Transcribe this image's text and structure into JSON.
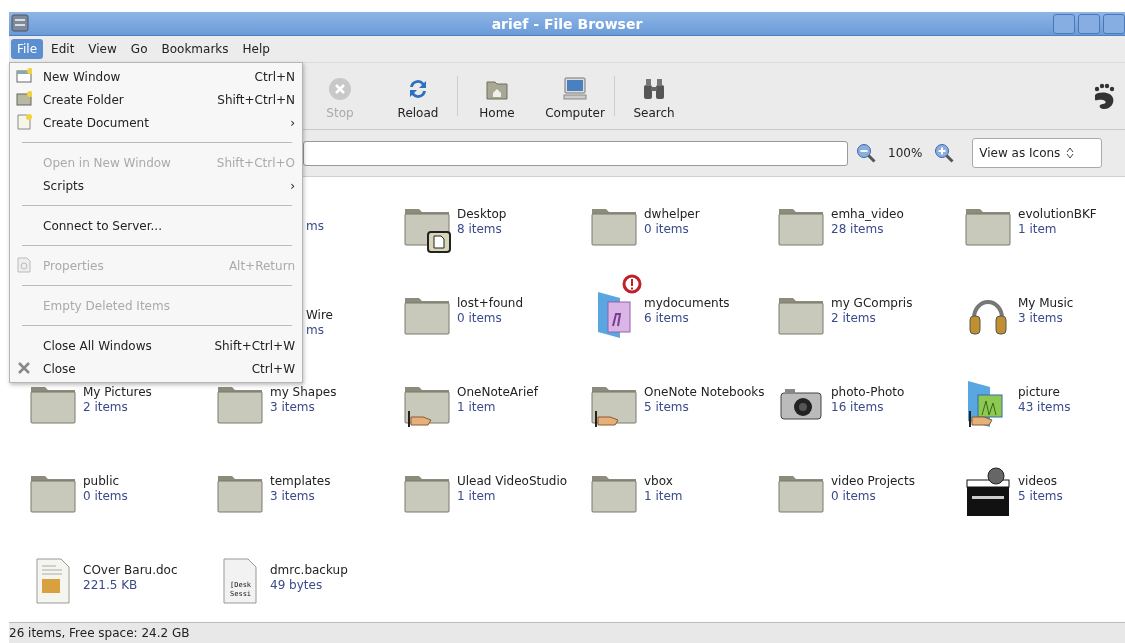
{
  "window": {
    "title": "arief - File Browser"
  },
  "menubar": [
    {
      "label": "File",
      "selected": true
    },
    {
      "label": "Edit",
      "selected": false
    },
    {
      "label": "View",
      "selected": false
    },
    {
      "label": "Go",
      "selected": false
    },
    {
      "label": "Bookmarks",
      "selected": false
    },
    {
      "label": "Help",
      "selected": false
    }
  ],
  "file_menu": [
    {
      "kind": "new-window",
      "label": "New Window",
      "shortcut": "Ctrl+N",
      "disabled": false
    },
    {
      "kind": "new-folder",
      "label": "Create Folder",
      "shortcut": "Shift+Ctrl+N",
      "disabled": false
    },
    {
      "kind": "new-document",
      "label": "Create Document",
      "arrow": "›",
      "disabled": false
    },
    {
      "kind": "separator"
    },
    {
      "kind": "plain",
      "label": "Open in New Window",
      "shortcut": "Shift+Ctrl+O",
      "disabled": true
    },
    {
      "kind": "plain",
      "label": "Scripts",
      "arrow": "›",
      "disabled": false
    },
    {
      "kind": "separator"
    },
    {
      "kind": "plain",
      "label": "Connect to Server...",
      "disabled": false
    },
    {
      "kind": "separator"
    },
    {
      "kind": "properties",
      "label": "Properties",
      "shortcut": "Alt+Return",
      "disabled": true
    },
    {
      "kind": "separator"
    },
    {
      "kind": "plain",
      "label": "Empty Deleted Items",
      "disabled": true
    },
    {
      "kind": "separator"
    },
    {
      "kind": "plain",
      "label": "Close All Windows",
      "shortcut": "Shift+Ctrl+W",
      "disabled": false
    },
    {
      "kind": "close",
      "label": "Close",
      "shortcut": "Ctrl+W",
      "disabled": false
    }
  ],
  "toolbar": [
    {
      "kind": "stop",
      "label": "Stop",
      "disabled": true
    },
    {
      "kind": "reload",
      "label": "Reload",
      "disabled": false
    },
    {
      "kind": "home",
      "label": "Home",
      "disabled": false
    },
    {
      "kind": "computer",
      "label": "Computer",
      "disabled": false
    },
    {
      "kind": "search",
      "label": "Search",
      "disabled": false
    }
  ],
  "location_bar": {
    "zoom": "100%",
    "view_mode": "View as Icons"
  },
  "files": [
    {
      "kind": "hidden"
    },
    {
      "kind": "partial",
      "detail": "ms"
    },
    {
      "kind": "folder-note",
      "name": "Desktop",
      "detail": "8 items"
    },
    {
      "kind": "folder",
      "name": "dwhelper",
      "detail": "0 items"
    },
    {
      "kind": "folder",
      "name": "emha_video",
      "detail": "28 items"
    },
    {
      "kind": "folder",
      "name": "evolutionBKF",
      "detail": "1 item"
    },
    {
      "kind": "hidden"
    },
    {
      "kind": "partial",
      "name": "Wire",
      "detail": "ms"
    },
    {
      "kind": "folder",
      "name": "lost+found",
      "detail": "0 items"
    },
    {
      "kind": "documents-alert",
      "name": "mydocuments",
      "detail": "6 items"
    },
    {
      "kind": "folder",
      "name": "my GCompris",
      "detail": "2 items"
    },
    {
      "kind": "music",
      "name": "My Music",
      "detail": "3 items"
    },
    {
      "kind": "folder",
      "name": "My Pictures",
      "detail": "2 items"
    },
    {
      "kind": "folder",
      "name": "my Shapes",
      "detail": "3 items"
    },
    {
      "kind": "folder-shared",
      "name": "OneNoteArief",
      "detail": "1 item"
    },
    {
      "kind": "folder-shared",
      "name": "OneNote Notebooks",
      "detail": "5 items"
    },
    {
      "kind": "camera",
      "name": "photo-Photo",
      "detail": "16 items"
    },
    {
      "kind": "pictures-shared",
      "name": "picture",
      "detail": "43 items"
    },
    {
      "kind": "folder",
      "name": "public",
      "detail": "0 items"
    },
    {
      "kind": "folder",
      "name": "templates",
      "detail": "3 items"
    },
    {
      "kind": "folder",
      "name": "Ulead VideoStudio",
      "detail": "1 item"
    },
    {
      "kind": "folder",
      "name": "vbox",
      "detail": "1 item"
    },
    {
      "kind": "folder",
      "name": "video Projects",
      "detail": "0 items"
    },
    {
      "kind": "video",
      "name": "videos",
      "detail": "5 items"
    },
    {
      "kind": "document",
      "name": "COver Baru.doc",
      "detail": "221.5 KB"
    },
    {
      "kind": "textfile",
      "preview": "[Desk Sessi",
      "name": "dmrc.backup",
      "detail": "49 bytes"
    }
  ],
  "status_bar": "26 items, Free space: 24.2 GB"
}
